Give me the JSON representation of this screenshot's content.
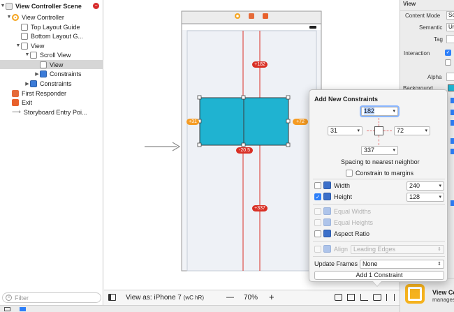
{
  "outline": {
    "scene_title": "View Controller Scene",
    "items": [
      {
        "label": "View Controller"
      },
      {
        "label": "Top Layout Guide"
      },
      {
        "label": "Bottom Layout G..."
      },
      {
        "label": "View"
      },
      {
        "label": "Scroll View"
      },
      {
        "label": "View"
      },
      {
        "label": "Constraints"
      },
      {
        "label": "Constraints"
      },
      {
        "label": "First Responder"
      },
      {
        "label": "Exit"
      },
      {
        "label": "Storyboard Entry Poi..."
      }
    ],
    "filter_placeholder": "Filter"
  },
  "canvas": {
    "constraint_labels": {
      "top": "+182",
      "left": "+31",
      "right": "+72",
      "bottom_offset": "-20.5",
      "bottom": "+337"
    },
    "accent_color": "#1fb3d1",
    "constraint_color": "#d93025"
  },
  "bottombar": {
    "view_as_label": "View as: iPhone 7",
    "view_as_size_class": "(wC hR)",
    "zoom_minus": "—",
    "zoom_value": "70%",
    "zoom_plus": "+"
  },
  "inspector": {
    "header": "View",
    "content_mode_label": "Content Mode",
    "content_mode_value": "Sc",
    "semantic_label": "Semantic",
    "semantic_value": "Un",
    "tag_label": "Tag",
    "interaction_label": "Interaction",
    "alpha_label": "Alpha",
    "background_label": "Background",
    "bottom_title": "View Co",
    "bottom_subtitle": "manages"
  },
  "popover": {
    "title": "Add New Constraints",
    "top_value": "182",
    "left_value": "31",
    "right_value": "72",
    "bottom_value": "337",
    "spacing_text": "Spacing to nearest neighbor",
    "constrain_margins": "Constrain to margins",
    "width_label": "Width",
    "width_value": "240",
    "height_label": "Height",
    "height_value": "128",
    "equal_widths": "Equal Widths",
    "equal_heights": "Equal Heights",
    "aspect_ratio": "Aspect Ratio",
    "align_label": "Align",
    "align_value": "Leading Edges",
    "update_frames_label": "Update Frames",
    "update_frames_value": "None",
    "add_button": "Add 1 Constraint"
  }
}
